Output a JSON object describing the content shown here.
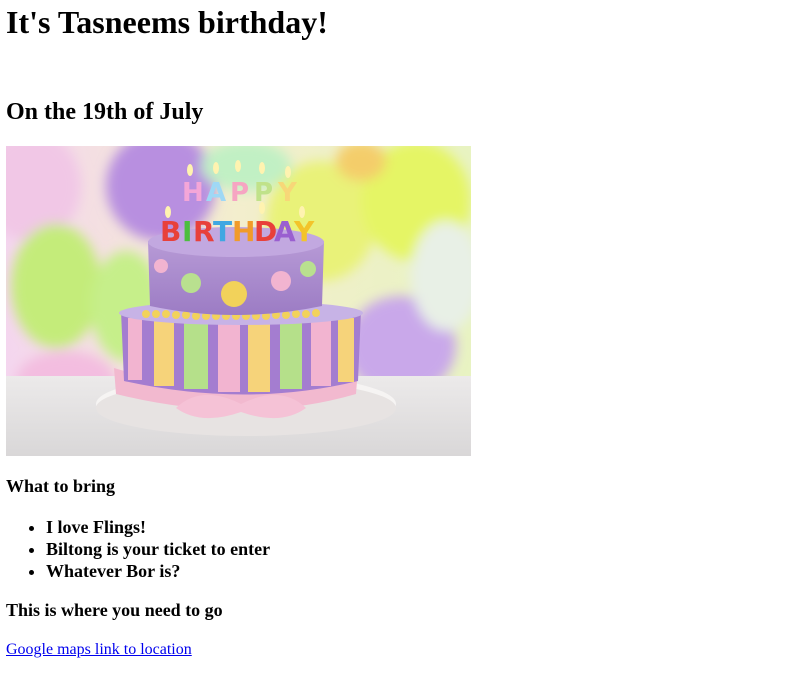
{
  "header": {
    "title": "It's Tasneems birthday!",
    "date": "On the 19th of July"
  },
  "hero": {
    "image": "birthday-cake-with-balloons",
    "candle_letters": [
      "H",
      "A",
      "P",
      "P",
      "Y",
      "B",
      "I",
      "R",
      "T",
      "H",
      "D",
      "A",
      "Y"
    ]
  },
  "bring": {
    "heading": "What to bring",
    "items": [
      "I love Flings!",
      "Biltong is your ticket to enter",
      "Whatever Bor is?"
    ]
  },
  "location": {
    "heading": "This is where you need to go",
    "link_text": "Google maps link to location"
  },
  "colors": {
    "link": "#0000ee",
    "text": "#000000",
    "background": "#ffffff"
  }
}
